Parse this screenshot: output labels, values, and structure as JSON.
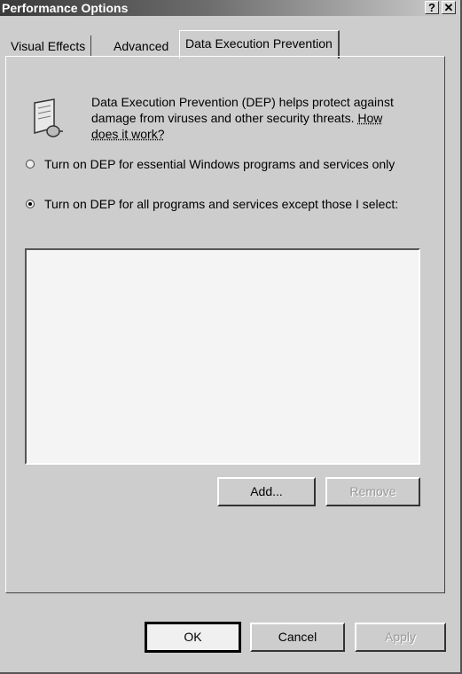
{
  "window": {
    "title": "Performance Options",
    "help_glyph": "?",
    "close_glyph": "✕"
  },
  "tabs": [
    {
      "label": "Visual Effects",
      "active": false
    },
    {
      "label": "Advanced",
      "active": false
    },
    {
      "label": "Data Execution Prevention",
      "active": true
    }
  ],
  "dep": {
    "description": "Data Execution Prevention (DEP) helps protect against damage from viruses and other security threats.",
    "link_text": "How does it work?",
    "options": [
      {
        "label": "Turn on DEP for essential Windows programs and services only",
        "selected": false
      },
      {
        "label": "Turn on DEP for all programs and services except those I select:",
        "selected": true
      }
    ],
    "add_label": "Add...",
    "remove_label": "Remove"
  },
  "footer": {
    "ok_label": "OK",
    "cancel_label": "Cancel",
    "apply_label": "Apply"
  },
  "icons": {
    "dep_icon": "shield-document-icon"
  }
}
